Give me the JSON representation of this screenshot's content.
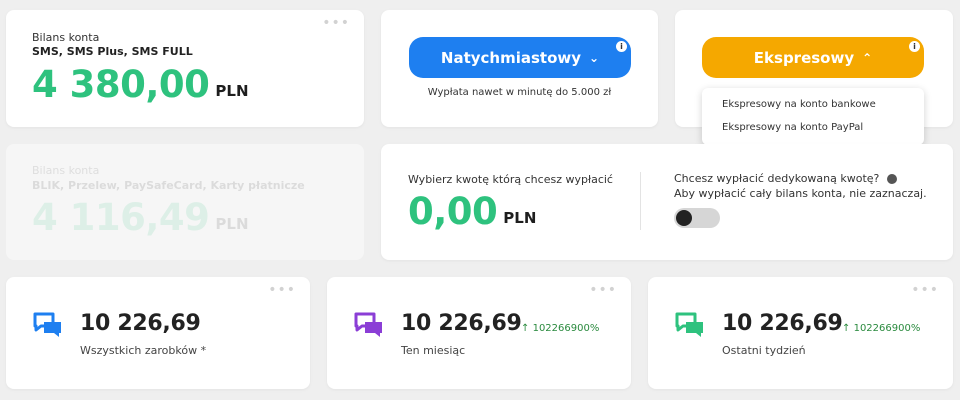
{
  "balance1": {
    "label": "Bilans konta",
    "sources": "SMS, SMS Plus, SMS FULL",
    "amount": "4 380,00",
    "currency": "PLN"
  },
  "balance2": {
    "label": "Bilans konta",
    "sources": "BLIK, Przelew, PaySafeCard, Karty płatnicze",
    "amount": "4 116,49",
    "currency": "PLN"
  },
  "instant": {
    "button_label": "Natychmiastowy",
    "info_glyph": "i",
    "note": "Wypłata nawet w minutę do 5.000 zł"
  },
  "express": {
    "button_label": "Ekspresowy",
    "info_glyph": "i",
    "options": [
      "Ekspresowy na konto bankowe",
      "Ekspresowy na konto PayPal"
    ]
  },
  "withdraw": {
    "label": "Wybierz kwotę którą chcesz wypłacić",
    "amount": "0,00",
    "currency": "PLN",
    "dedicated_q": "Chcesz wypłacić dedykowaną kwotę?",
    "dedicated_hint": "Aby wypłacić cały bilans konta, nie zaznaczaj.",
    "toggle_on": false
  },
  "stats": [
    {
      "value": "10 226,69",
      "label": "Wszystkich zarobków *",
      "trend": "",
      "icon": "chat-icon",
      "color": "#1e7ff0"
    },
    {
      "value": "10 226,69",
      "label": "Ten miesiąc",
      "trend": "102266900%",
      "icon": "chat-icon",
      "color": "#8b3ed6"
    },
    {
      "value": "10 226,69",
      "label": "Ostatni tydzień",
      "trend": "102266900%",
      "icon": "chat-icon",
      "color": "#2ec27e"
    }
  ],
  "colors": {
    "green": "#2ec27e",
    "blue": "#1e7ff0",
    "orange": "#f5a800",
    "purple": "#8b3ed6",
    "trend_green": "#2a8a3e"
  }
}
